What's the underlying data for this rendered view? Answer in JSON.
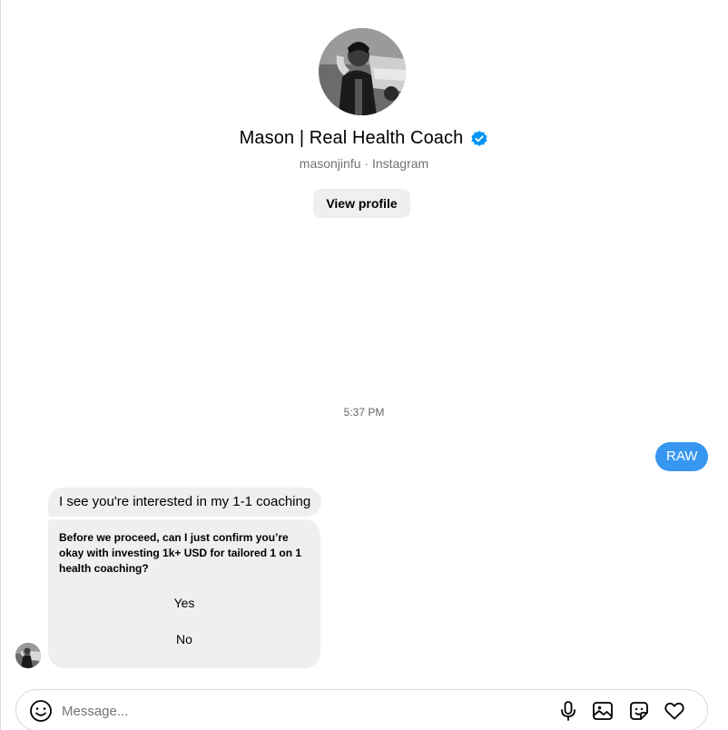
{
  "header": {
    "name": "Mason | Real Health Coach",
    "verified": true,
    "subtitle": "masonjinfu · Instagram",
    "view_profile_label": "View profile"
  },
  "thread": {
    "timestamp": "5:37 PM",
    "messages": [
      {
        "from": "me",
        "text": "RAW"
      },
      {
        "from": "them",
        "text": "I see you're interested in my 1-1 coaching"
      }
    ],
    "card": {
      "question": "Before we proceed, can I just confirm you’re okay with investing 1k+ USD for tailored 1 on 1 health coaching?",
      "options": [
        "Yes",
        "No"
      ]
    }
  },
  "composer": {
    "placeholder": "Message..."
  },
  "colors": {
    "accent": "#3797f0",
    "bubble_in": "#efefef",
    "verified": "#0095f6"
  },
  "icons": [
    "verified-badge-icon",
    "emoji-icon",
    "microphone-icon",
    "image-icon",
    "sticker-icon",
    "heart-icon"
  ]
}
